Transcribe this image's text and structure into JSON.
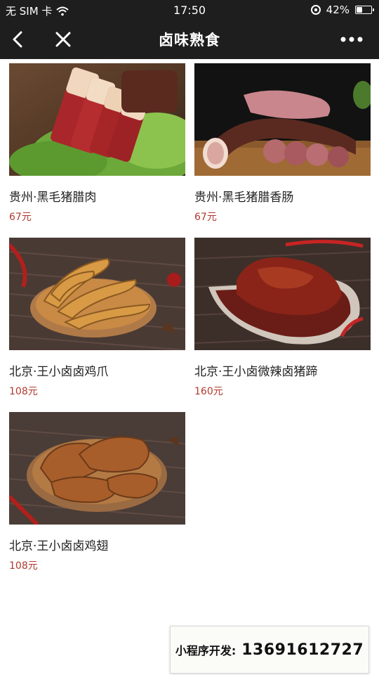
{
  "status_bar": {
    "carrier": "无 SIM 卡",
    "time": "17:50",
    "battery": "42%",
    "battery_level": 0.42
  },
  "nav": {
    "title": "卤味熟食"
  },
  "products": [
    {
      "name": "贵州·黑毛猪腊肉",
      "price": "67元"
    },
    {
      "name": "贵州·黑毛猪腊香肠",
      "price": "67元"
    },
    {
      "name": "北京·王小卤卤鸡爪",
      "price": "108元"
    },
    {
      "name": "北京·王小卤微辣卤猪蹄",
      "price": "160元"
    },
    {
      "name": "北京·王小卤卤鸡翅",
      "price": "108元"
    }
  ],
  "contact": {
    "label": "小程序开发:",
    "phone": "13691612727"
  },
  "colors": {
    "bar_bg": "#1e1e1e",
    "price": "#b03a2e"
  }
}
